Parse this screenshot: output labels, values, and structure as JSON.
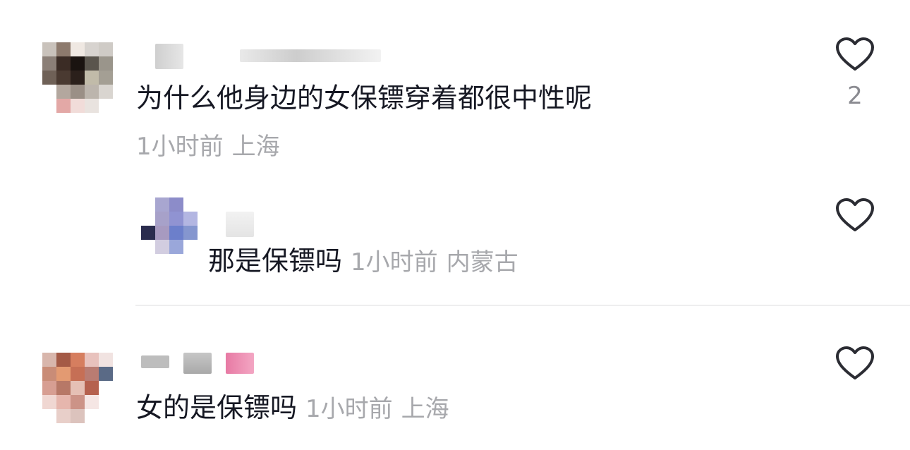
{
  "comments": [
    {
      "text": "为什么他身边的女保镖穿着都很中性呢",
      "time": "1小时前",
      "location": "上海",
      "likes": "2",
      "replies": [
        {
          "text": "那是保镖吗",
          "time": "1小时前",
          "location": "内蒙古"
        }
      ]
    },
    {
      "text": "女的是保镖吗",
      "time": "1小时前",
      "location": "上海"
    }
  ],
  "icons": {
    "like": "heart-outline-icon"
  },
  "colors": {
    "text_primary": "#161823",
    "text_secondary": "#a7a8ac",
    "icon": "#2b2c33"
  }
}
